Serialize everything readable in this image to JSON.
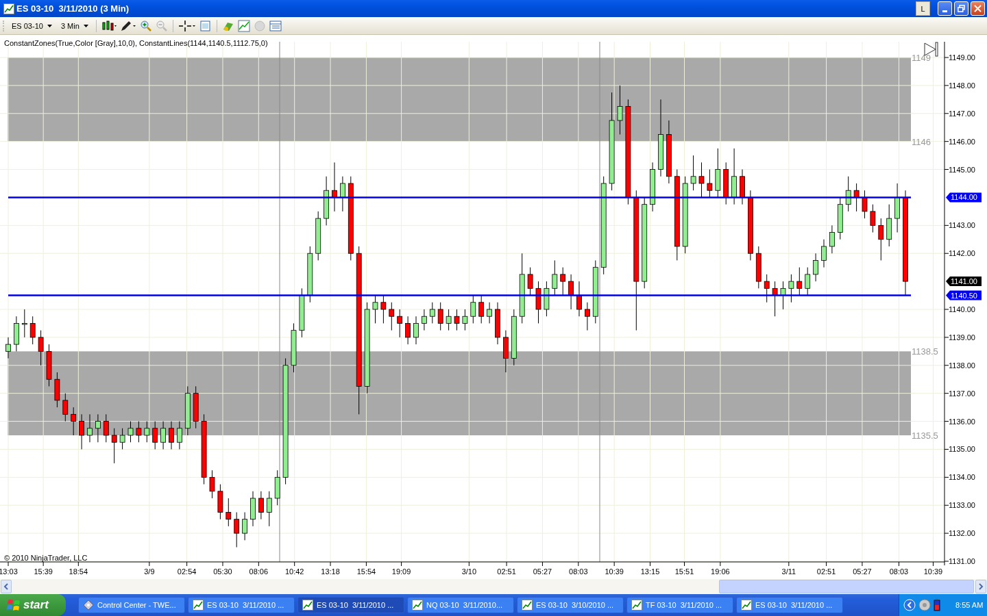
{
  "window": {
    "title": "ES 03-10  3/11/2010 (3 Min)",
    "link_button": "L"
  },
  "toolbar": {
    "instrument": "ES 03-10",
    "interval": "3 Min"
  },
  "chart": {
    "indicator_label": "ConstantZones(True,Color [Gray],10,0), ConstantLines(1144,1140.5,1112.75,0)",
    "copyright": "© 2010 NinjaTrader, LLC",
    "zones": [
      {
        "top_label": "1149",
        "bottom_label": "1146"
      },
      {
        "top_label": "1138.5",
        "bottom_label": "1135.5"
      }
    ],
    "price_markers": [
      {
        "label": "1144.00",
        "color": "#0000ff"
      },
      {
        "label": "1141.00",
        "color": "#000000"
      },
      {
        "label": "1140.50",
        "color": "#0000ff"
      }
    ],
    "time_labels": [
      "13:03",
      "15:39",
      "18:54",
      "3/9",
      "02:54",
      "05:30",
      "08:06",
      "10:42",
      "13:18",
      "15:54",
      "19:09",
      "3/10",
      "02:51",
      "05:27",
      "08:03",
      "10:39",
      "13:15",
      "15:51",
      "19:06",
      "3/11",
      "02:51",
      "05:27",
      "08:03",
      "10:39"
    ],
    "chart_data": {
      "type": "candlestick",
      "ylim": [
        1131,
        1149
      ],
      "grid": true,
      "yticks": [
        {
          "value": 1149,
          "label": "1149.00"
        },
        {
          "value": 1148,
          "label": "1148.00"
        },
        {
          "value": 1147,
          "label": "1147.00"
        },
        {
          "value": 1146,
          "label": "1146.00"
        },
        {
          "value": 1145,
          "label": "1145.00"
        },
        {
          "value": 1143,
          "label": "1143.00"
        },
        {
          "value": 1142,
          "label": "1142.00"
        },
        {
          "value": 1140,
          "label": "1140.00"
        },
        {
          "value": 1139,
          "label": "1139.00"
        },
        {
          "value": 1138,
          "label": "1138.00"
        },
        {
          "value": 1137,
          "label": "1137.00"
        },
        {
          "value": 1136,
          "label": "1136.00"
        },
        {
          "value": 1135,
          "label": "1135.00"
        },
        {
          "value": 1134,
          "label": "1134.00"
        },
        {
          "value": 1133,
          "label": "1133.00"
        },
        {
          "value": 1132,
          "label": "1132.00"
        },
        {
          "value": 1131,
          "label": "1131.00"
        }
      ],
      "ohlc": [
        [
          1138.5,
          1139.0,
          1138.25,
          1138.75
        ],
        [
          1138.75,
          1139.75,
          1138.5,
          1139.5
        ],
        [
          1139.5,
          1140.0,
          1139.0,
          1139.5
        ],
        [
          1139.5,
          1139.75,
          1138.75,
          1139.0
        ],
        [
          1139.0,
          1139.25,
          1138.0,
          1138.5
        ],
        [
          1138.5,
          1138.75,
          1137.25,
          1137.5
        ],
        [
          1137.5,
          1137.75,
          1136.5,
          1136.75
        ],
        [
          1136.75,
          1137.0,
          1136.0,
          1136.25
        ],
        [
          1136.25,
          1136.5,
          1135.5,
          1136.0
        ],
        [
          1136.0,
          1136.25,
          1135.0,
          1135.5
        ],
        [
          1135.5,
          1136.25,
          1135.25,
          1135.75
        ],
        [
          1135.75,
          1136.25,
          1135.25,
          1136.0
        ],
        [
          1136.0,
          1136.25,
          1135.25,
          1135.5
        ],
        [
          1135.5,
          1135.75,
          1134.5,
          1135.25
        ],
        [
          1135.25,
          1135.75,
          1135.0,
          1135.5
        ],
        [
          1135.5,
          1136.0,
          1135.25,
          1135.75
        ],
        [
          1135.75,
          1136.0,
          1135.25,
          1135.5
        ],
        [
          1135.5,
          1136.0,
          1135.25,
          1135.75
        ],
        [
          1135.75,
          1136.0,
          1135.0,
          1135.25
        ],
        [
          1135.25,
          1136.0,
          1135.0,
          1135.75
        ],
        [
          1135.75,
          1136.0,
          1135.0,
          1135.25
        ],
        [
          1135.25,
          1136.0,
          1135.0,
          1135.75
        ],
        [
          1135.75,
          1137.25,
          1135.5,
          1137.0
        ],
        [
          1137.0,
          1137.25,
          1135.75,
          1136.0
        ],
        [
          1136.0,
          1136.25,
          1133.75,
          1134.0
        ],
        [
          1134.0,
          1134.25,
          1133.25,
          1133.5
        ],
        [
          1133.5,
          1133.75,
          1132.5,
          1132.75
        ],
        [
          1132.75,
          1133.25,
          1132.25,
          1132.5
        ],
        [
          1132.5,
          1132.75,
          1131.5,
          1132.0
        ],
        [
          1132.0,
          1132.75,
          1131.75,
          1132.5
        ],
        [
          1132.5,
          1133.5,
          1132.25,
          1133.25
        ],
        [
          1133.25,
          1133.5,
          1132.5,
          1132.75
        ],
        [
          1132.75,
          1133.5,
          1132.25,
          1133.25
        ],
        [
          1133.25,
          1134.25,
          1133.0,
          1134.0
        ],
        [
          1134.0,
          1138.25,
          1133.75,
          1138.0
        ],
        [
          1138.0,
          1139.5,
          1137.75,
          1139.25
        ],
        [
          1139.25,
          1140.75,
          1139.0,
          1140.5
        ],
        [
          1140.5,
          1142.25,
          1140.25,
          1142.0
        ],
        [
          1142.0,
          1143.5,
          1141.75,
          1143.25
        ],
        [
          1143.25,
          1144.75,
          1143.0,
          1144.25
        ],
        [
          1144.25,
          1145.25,
          1143.5,
          1144.0
        ],
        [
          1144.0,
          1144.75,
          1143.5,
          1144.5
        ],
        [
          1144.5,
          1144.75,
          1141.75,
          1142.0
        ],
        [
          1142.0,
          1142.25,
          1136.25,
          1137.25
        ],
        [
          1137.25,
          1140.25,
          1137.0,
          1140.0
        ],
        [
          1140.0,
          1140.5,
          1139.5,
          1140.25
        ],
        [
          1140.25,
          1140.5,
          1139.5,
          1140.0
        ],
        [
          1140.0,
          1140.25,
          1139.25,
          1139.75
        ],
        [
          1139.75,
          1140.0,
          1139.0,
          1139.5
        ],
        [
          1139.5,
          1139.75,
          1138.75,
          1139.0
        ],
        [
          1139.0,
          1139.75,
          1138.75,
          1139.5
        ],
        [
          1139.5,
          1140.0,
          1139.25,
          1139.75
        ],
        [
          1139.75,
          1140.25,
          1139.5,
          1140.0
        ],
        [
          1140.0,
          1140.25,
          1139.25,
          1139.5
        ],
        [
          1139.5,
          1140.0,
          1139.25,
          1139.75
        ],
        [
          1139.75,
          1140.0,
          1139.25,
          1139.5
        ],
        [
          1139.5,
          1140.0,
          1139.25,
          1139.75
        ],
        [
          1139.75,
          1140.5,
          1139.5,
          1140.25
        ],
        [
          1140.25,
          1140.5,
          1139.5,
          1139.75
        ],
        [
          1139.75,
          1140.25,
          1139.5,
          1140.0
        ],
        [
          1140.0,
          1140.25,
          1138.75,
          1139.0
        ],
        [
          1139.0,
          1139.25,
          1137.75,
          1138.25
        ],
        [
          1138.25,
          1140.0,
          1138.0,
          1139.75
        ],
        [
          1139.75,
          1142.0,
          1139.5,
          1141.25
        ],
        [
          1141.25,
          1141.5,
          1140.5,
          1140.75
        ],
        [
          1140.75,
          1141.0,
          1139.5,
          1140.0
        ],
        [
          1140.0,
          1141.0,
          1139.75,
          1140.75
        ],
        [
          1140.75,
          1141.75,
          1140.5,
          1141.25
        ],
        [
          1141.25,
          1141.5,
          1140.5,
          1141.0
        ],
        [
          1141.0,
          1141.25,
          1140.0,
          1140.5
        ],
        [
          1140.5,
          1141.0,
          1139.75,
          1140.0
        ],
        [
          1140.0,
          1140.25,
          1139.25,
          1139.75
        ],
        [
          1139.75,
          1141.75,
          1139.5,
          1141.5
        ],
        [
          1141.5,
          1144.75,
          1141.25,
          1144.5
        ],
        [
          1144.5,
          1147.75,
          1144.25,
          1146.75
        ],
        [
          1146.75,
          1148.0,
          1146.25,
          1147.25
        ],
        [
          1147.25,
          1147.5,
          1143.75,
          1144.0
        ],
        [
          1144.0,
          1144.25,
          1139.25,
          1141.0
        ],
        [
          1141.0,
          1144.0,
          1140.75,
          1143.75
        ],
        [
          1143.75,
          1145.25,
          1143.5,
          1145.0
        ],
        [
          1145.0,
          1147.5,
          1144.75,
          1146.25
        ],
        [
          1146.25,
          1146.75,
          1144.5,
          1144.75
        ],
        [
          1144.75,
          1145.0,
          1141.75,
          1142.25
        ],
        [
          1142.25,
          1144.75,
          1142.0,
          1144.5
        ],
        [
          1144.5,
          1145.5,
          1144.25,
          1144.75
        ],
        [
          1144.75,
          1145.25,
          1144.0,
          1144.5
        ],
        [
          1144.5,
          1145.0,
          1144.0,
          1144.25
        ],
        [
          1144.25,
          1145.75,
          1144.0,
          1145.0
        ],
        [
          1145.0,
          1145.25,
          1143.75,
          1144.0
        ],
        [
          1144.0,
          1145.75,
          1143.75,
          1144.75
        ],
        [
          1144.75,
          1145.0,
          1143.75,
          1144.0
        ],
        [
          1144.0,
          1144.25,
          1141.75,
          1142.0
        ],
        [
          1142.0,
          1142.25,
          1140.75,
          1141.0
        ],
        [
          1141.0,
          1141.25,
          1140.25,
          1140.75
        ],
        [
          1140.75,
          1141.0,
          1139.75,
          1140.5
        ],
        [
          1140.5,
          1141.0,
          1140.0,
          1140.75
        ],
        [
          1140.75,
          1141.25,
          1140.25,
          1141.0
        ],
        [
          1141.0,
          1141.5,
          1140.5,
          1140.75
        ],
        [
          1140.75,
          1141.5,
          1140.5,
          1141.25
        ],
        [
          1141.25,
          1142.0,
          1141.0,
          1141.75
        ],
        [
          1141.75,
          1142.5,
          1141.5,
          1142.25
        ],
        [
          1142.25,
          1143.0,
          1142.0,
          1142.75
        ],
        [
          1142.75,
          1144.0,
          1142.5,
          1143.75
        ],
        [
          1143.75,
          1144.75,
          1143.5,
          1144.25
        ],
        [
          1144.25,
          1144.5,
          1143.5,
          1144.0
        ],
        [
          1144.0,
          1144.25,
          1143.25,
          1143.5
        ],
        [
          1143.5,
          1143.75,
          1142.75,
          1143.0
        ],
        [
          1143.0,
          1143.25,
          1141.75,
          1142.5
        ],
        [
          1142.5,
          1143.75,
          1142.25,
          1143.25
        ],
        [
          1143.25,
          1144.5,
          1142.75,
          1144.0
        ],
        [
          1144.0,
          1144.25,
          1140.5,
          1141.0
        ]
      ]
    }
  },
  "taskbar": {
    "start": "start",
    "tasks": [
      {
        "label": "Control Center - TWE...",
        "kind": "control",
        "selected": false
      },
      {
        "label": "ES 03-10  3/11/2010 ...",
        "kind": "chart",
        "selected": false
      },
      {
        "label": "ES 03-10  3/11/2010 ...",
        "kind": "chart",
        "selected": true
      },
      {
        "label": "NQ 03-10  3/11/2010...",
        "kind": "chart",
        "selected": false
      },
      {
        "label": "ES 03-10  3/10/2010 ...",
        "kind": "chart",
        "selected": false
      },
      {
        "label": "TF 03-10  3/11/2010 ...",
        "kind": "chart",
        "selected": false
      },
      {
        "label": "ES 03-10  3/11/2010 ...",
        "kind": "chart",
        "selected": false
      }
    ],
    "clock": "8:55 AM"
  }
}
